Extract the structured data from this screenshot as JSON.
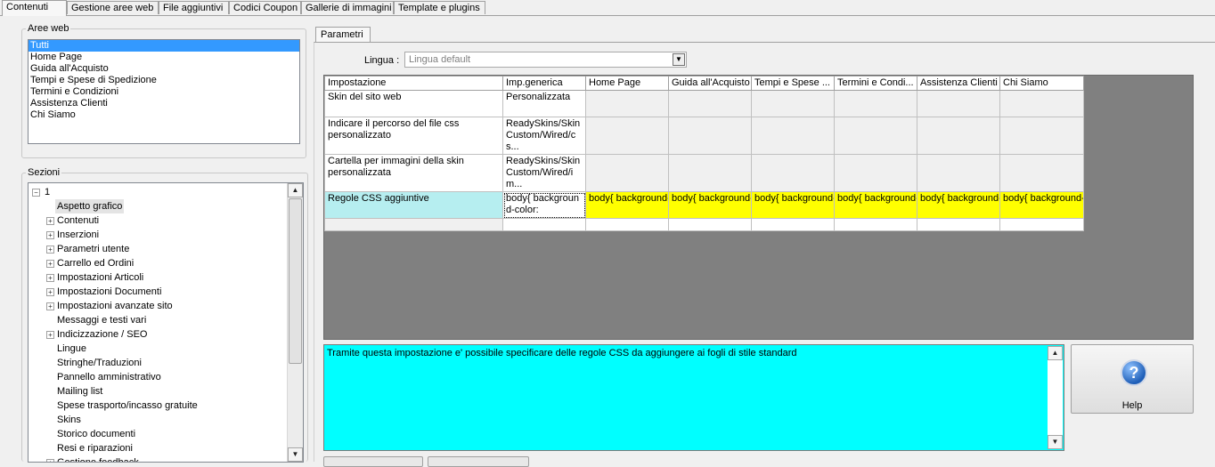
{
  "top_tabs": [
    "Contenuti",
    "Gestione aree web",
    "File aggiuntivi",
    "Codici Coupon",
    "Gallerie di immagini",
    "Template e plugins"
  ],
  "aree_web": {
    "legend": "Aree web",
    "items": [
      "Tutti",
      "Home Page",
      "Guida all'Acquisto",
      "Tempi e Spese di Spedizione",
      "Termini e Condizioni",
      "Assistenza Clienti",
      "Chi Siamo"
    ]
  },
  "sezioni": {
    "legend": "Sezioni",
    "root": "1",
    "items": [
      {
        "label": "Aspetto grafico",
        "expander": false
      },
      {
        "label": "Contenuti",
        "expander": true
      },
      {
        "label": "Inserzioni",
        "expander": true
      },
      {
        "label": "Parametri utente",
        "expander": true
      },
      {
        "label": "Carrello ed Ordini",
        "expander": true
      },
      {
        "label": "Impostazioni Articoli",
        "expander": true
      },
      {
        "label": "Impostazioni Documenti",
        "expander": true
      },
      {
        "label": "Impostazioni avanzate sito",
        "expander": true
      },
      {
        "label": "Messaggi e testi vari",
        "expander": false
      },
      {
        "label": "Indicizzazione / SEO",
        "expander": true
      },
      {
        "label": "Lingue",
        "expander": false
      },
      {
        "label": "Stringhe/Traduzioni",
        "expander": false
      },
      {
        "label": "Pannello amministrativo",
        "expander": false
      },
      {
        "label": "Mailing list",
        "expander": false
      },
      {
        "label": "Spese trasporto/incasso gratuite",
        "expander": false
      },
      {
        "label": "Skins",
        "expander": false
      },
      {
        "label": "Storico documenti",
        "expander": false
      },
      {
        "label": "Resi e riparazioni",
        "expander": false
      },
      {
        "label": "Gestione feedback",
        "expander": true
      }
    ]
  },
  "parametri": {
    "tab": "Parametri",
    "lingua_label": "Lingua :",
    "lingua_value": "Lingua default",
    "columns": [
      "Impostazione",
      "Imp.generica",
      "Home Page",
      "Guida all'Acquisto",
      "Tempi e Spese ...",
      "Termini e Condi...",
      "Assistenza Clienti",
      "Chi Siamo"
    ],
    "rows": [
      {
        "label": "Skin del sito web",
        "generic": "Personalizzata",
        "cells": [
          "",
          "",
          "",
          "",
          "",
          ""
        ]
      },
      {
        "label": "Indicare il percorso del file css personalizzato",
        "generic": "ReadySkins/SkinCustom/Wired/cs...",
        "cells": [
          "",
          "",
          "",
          "",
          "",
          ""
        ]
      },
      {
        "label": "Cartella per immagini della skin personalizzata",
        "generic": "ReadySkins/SkinCustom/Wired/im...",
        "cells": [
          "",
          "",
          "",
          "",
          "",
          ""
        ]
      },
      {
        "label": "Regole CSS aggiuntive",
        "generic": "body{ background-color:",
        "cells": [
          "body{ background-color:",
          "body{ background-color:",
          "body{ background-color:",
          "body{ background-color:",
          "body{ background-color:",
          "body{ background-color:"
        ]
      }
    ],
    "description": "Tramite questa impostazione e' possibile specificare delle regole CSS da aggiungere ai fogli di stile standard",
    "help_label": "Help",
    "help_glyph": "?"
  },
  "colors": {
    "description_bg": "#00ffff",
    "highlight_cell": "#ffff00",
    "selected_row_label": "#b6eef0",
    "selection": "#3399ff"
  }
}
